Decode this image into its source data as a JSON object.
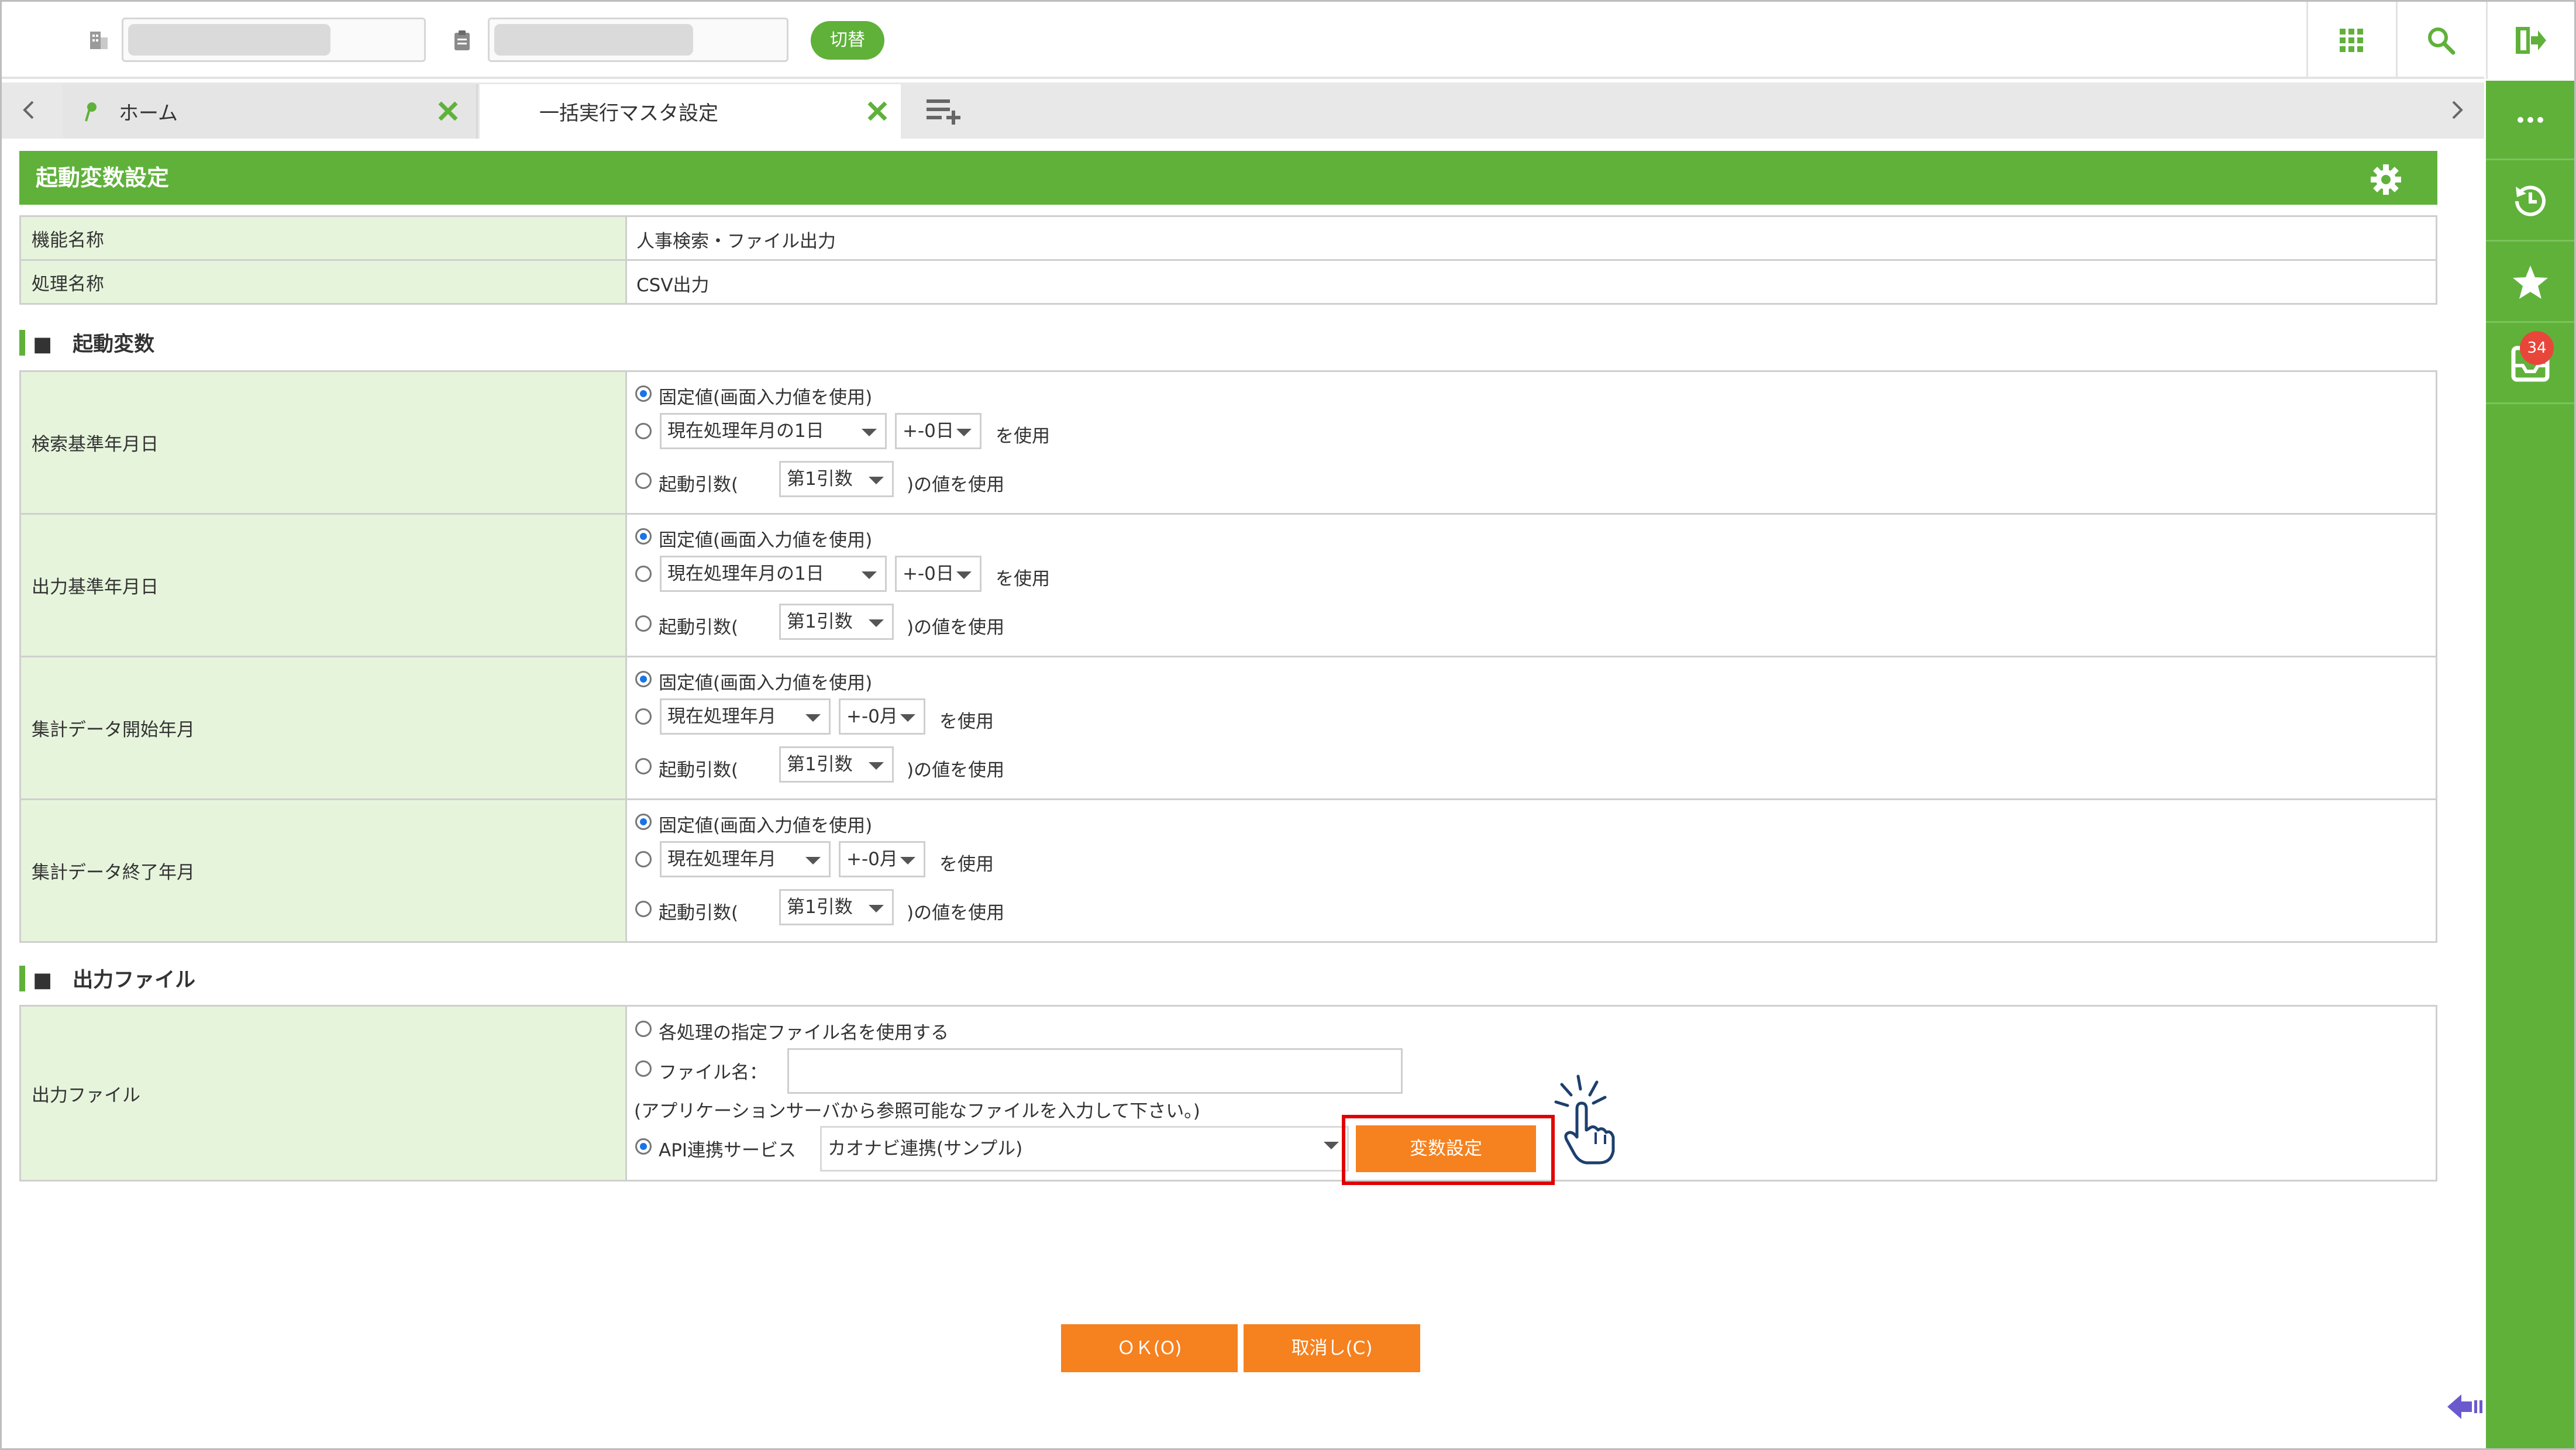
{
  "topbar": {
    "switch_label": "切替"
  },
  "tabs": {
    "home_label": "ホーム",
    "active_label": "一括実行マスタ設定"
  },
  "header": {
    "title": "起動変数設定"
  },
  "info": [
    {
      "label": "機能名称",
      "value": "人事検索・ファイル出力"
    },
    {
      "label": "処理名称",
      "value": "CSV出力"
    }
  ],
  "sections": {
    "startup_vars": "■　起動変数",
    "output_file": "■　出力ファイル"
  },
  "params": [
    {
      "label": "検索基準年月日",
      "fixed": "固定値(画面入力値を使用)",
      "base": "現在処理年月の1日",
      "offset": "+-0日",
      "use": "を使用",
      "arg_prefix": "起動引数(",
      "arg": "第1引数",
      "arg_suffix": ")の値を使用"
    },
    {
      "label": "出力基準年月日",
      "fixed": "固定値(画面入力値を使用)",
      "base": "現在処理年月の1日",
      "offset": "+-0日",
      "use": "を使用",
      "arg_prefix": "起動引数(",
      "arg": "第1引数",
      "arg_suffix": ")の値を使用"
    },
    {
      "label": "集計データ開始年月",
      "fixed": "固定値(画面入力値を使用)",
      "base": "現在処理年月",
      "offset": "+-0月",
      "use": "を使用",
      "arg_prefix": "起動引数(",
      "arg": "第1引数",
      "arg_suffix": ")の値を使用"
    },
    {
      "label": "集計データ終了年月",
      "fixed": "固定値(画面入力値を使用)",
      "base": "現在処理年月",
      "offset": "+-0月",
      "use": "を使用",
      "arg_prefix": "起動引数(",
      "arg": "第1引数",
      "arg_suffix": ")の値を使用"
    }
  ],
  "output": {
    "label": "出力ファイル",
    "opt1": "各処理の指定ファイル名を使用する",
    "opt2": "ファイル名：",
    "note": "(アプリケーションサーバから参照可能なファイルを入力して下さい。)",
    "opt3": "API連携サービス",
    "service": "カオナビ連携(サンプル)",
    "var_button": "変数設定"
  },
  "footer": {
    "ok": "ＯＫ(O)",
    "cancel": "取消し(C)"
  },
  "sidebar": {
    "badge": "34"
  },
  "colors": {
    "accent": "#5fb13a",
    "button": "#f5811f",
    "highlight": "#e00000"
  }
}
